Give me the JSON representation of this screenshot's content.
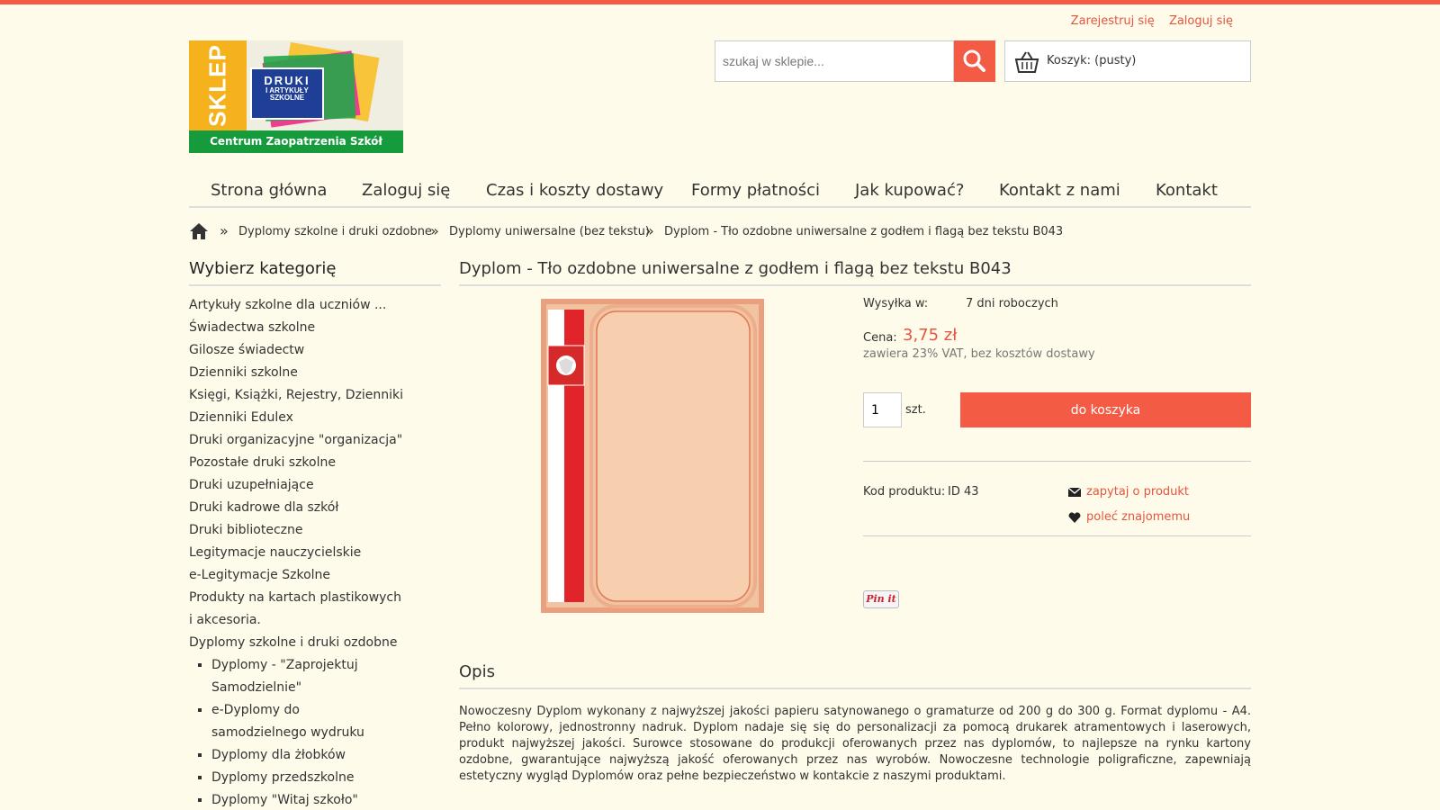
{
  "colors": {
    "accent": "#f45b44",
    "link": "#e4553e",
    "background": "#fffbea"
  },
  "auth": {
    "register": "Zarejestruj się",
    "login": "Zaloguj się"
  },
  "logo": {
    "sklep": "SKLEP",
    "druki_line1": "DRUKI",
    "druki_line2": "I ARTYKUŁY",
    "druki_line3": "SZKOLNE",
    "band": "Centrum Zaopatrzenia Szkół"
  },
  "search": {
    "placeholder": "szukaj w sklepie...",
    "icon": "search-icon"
  },
  "cart": {
    "label": "Koszyk: (pusty)",
    "icon": "basket-icon"
  },
  "nav": [
    "Strona główna",
    "Zaloguj się",
    "Czas i koszty dostawy",
    "Formy płatności",
    "Jak kupować?",
    "Kontakt z nami",
    "Kontakt"
  ],
  "breadcrumb": [
    "Dyplomy szkolne i druki ozdobne",
    "Dyplomy uniwersalne (bez tekstu)",
    "Dyplom - Tło ozdobne uniwersalne z godłem i flagą bez tekstu B043"
  ],
  "breadcrumb_sep": "»",
  "sidebar": {
    "title": "Wybierz kategorię",
    "categories": [
      "Artykuły szkolne dla uczniów ...",
      "Świadectwa szkolne",
      "Gilosze świadectw",
      "Dzienniki szkolne",
      "Księgi, Książki, Rejestry, Dzienniki",
      "Dzienniki Edulex",
      "Druki organizacyjne \"organizacja\"",
      "Pozostałe druki szkolne",
      "Druki uzupełniające",
      "Druki kadrowe dla szkół",
      "Druki biblioteczne",
      "Legitymacje nauczycielskie",
      "e-Legitymacje Szkolne",
      "Produkty na kartach plastikowych i akcesoria.",
      "Dyplomy szkolne i druki ozdobne"
    ],
    "subcategories": [
      "Dyplomy - \"Zaprojektuj Samodzielnie\"",
      "e-Dyplomy do samodzielnego wydruku",
      "Dyplomy dla żłobków",
      "Dyplomy przedszkolne",
      "Dyplomy \"Witaj szkoło\""
    ]
  },
  "product": {
    "title": "Dyplom - Tło ozdobne uniwersalne z godłem i flagą bez tekstu B043",
    "shipping_label": "Wysyłka w:",
    "shipping_value": "7 dni roboczych",
    "price_label": "Cena:",
    "price": "3,75 zł",
    "vat_note": "zawiera 23% VAT, bez kosztów dostawy",
    "quantity": "1",
    "unit": "szt.",
    "add_to_cart": "do koszyka",
    "code_label": "Kod produktu:",
    "code_value": "ID 43",
    "ask": "zapytaj o produkt",
    "recommend": "poleć znajomemu",
    "pinit": "Pin it"
  },
  "description": {
    "title": "Opis",
    "text": "Nowoczesny Dyplom wykonany z najwyższej jakości papieru satynowanego o gramaturze od 200 g do 300 g. Format dyplomu - A4. Pełno kolorowy, jednostronny nadruk. Dyplom nadaje się się do personalizacji za pomocą drukarek atramentowych i laserowych, produkt najwyższej jakości. Surowce stosowane do produkcji oferowanych przez nas dyplomów, to najlepsze na rynku kartony ozdobne, gwarantujące najwyższą jakość oferowanych przez nas wyrobów. Nowoczesne technologie poligraficzne, zapewniają estetyczny wygląd Dyplomów oraz pełne bezpieczeństwo w kontakcie z naszymi produktami."
  }
}
